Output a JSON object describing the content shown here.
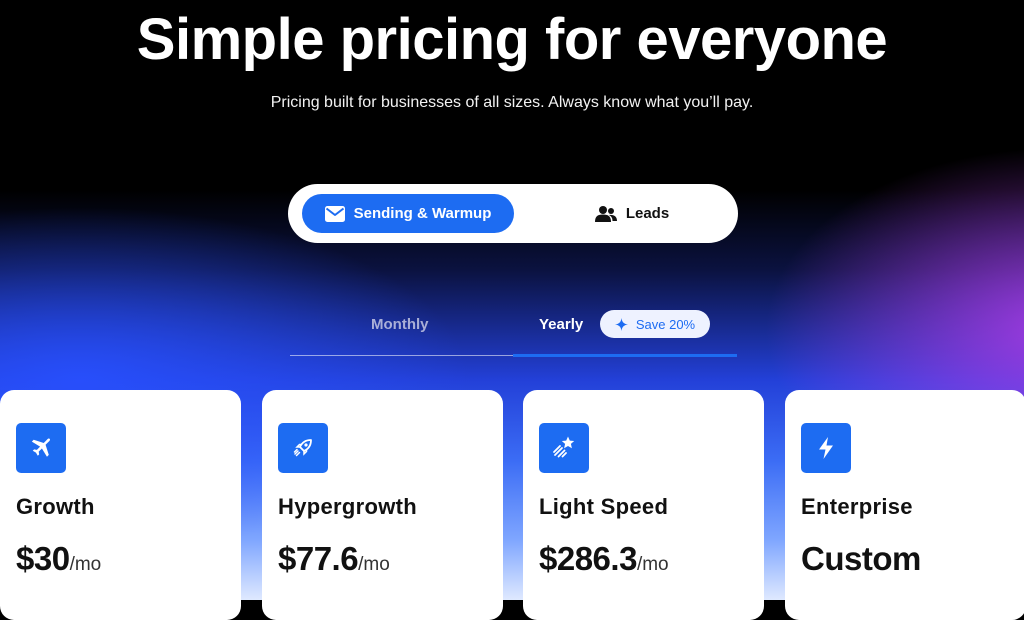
{
  "hero": {
    "title": "Simple pricing for everyone",
    "subtitle": "Pricing built for businesses of all sizes. Always know what you’ll pay."
  },
  "product_switch": {
    "options": [
      {
        "label": "Sending & Warmup",
        "icon": "mail-icon",
        "active": true
      },
      {
        "label": "Leads",
        "icon": "users-icon",
        "active": false
      }
    ]
  },
  "billing": {
    "monthly_label": "Monthly",
    "yearly_label": "Yearly",
    "selected": "Yearly",
    "save_badge": "Save 20%",
    "save_icon": "sparkle-icon"
  },
  "plans": [
    {
      "name": "Growth",
      "price": "$30",
      "unit": "/mo",
      "icon": "airplane-icon"
    },
    {
      "name": "Hypergrowth",
      "price": "$77.6",
      "unit": "/mo",
      "icon": "rocket-icon"
    },
    {
      "name": "Light Speed",
      "price": "$286.3",
      "unit": "/mo",
      "icon": "shooting-star-icon"
    },
    {
      "name": "Enterprise",
      "price": "Custom",
      "unit": "",
      "icon": "lightning-icon"
    }
  ],
  "colors": {
    "accent": "#1d6cf2",
    "background_top": "#000000",
    "glow_blue": "#2850ff",
    "glow_purple": "#a83ce6",
    "card": "#ffffff"
  }
}
